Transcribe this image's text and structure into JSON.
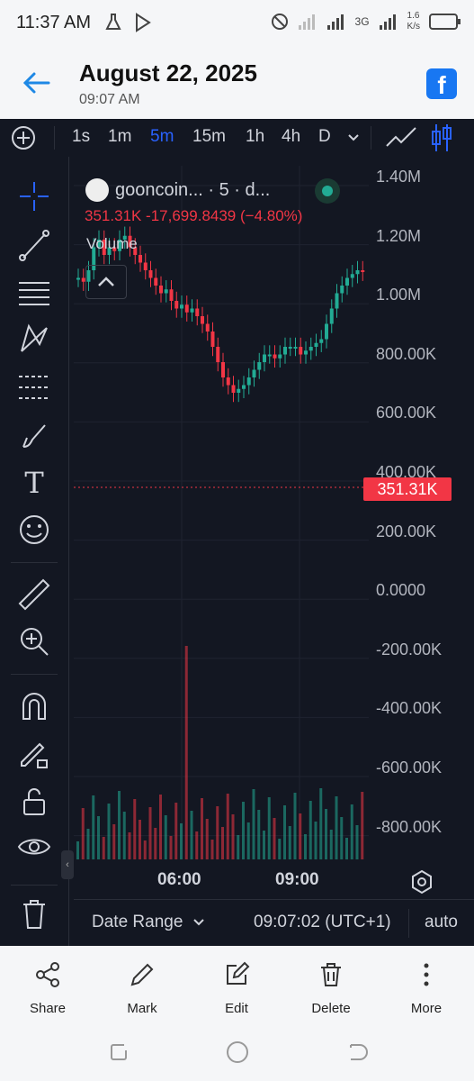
{
  "status_bar": {
    "time": "11:37 AM",
    "net_type": "3G",
    "speed": "1.6",
    "speed_unit": "K/s"
  },
  "header": {
    "date": "August 22, 2025",
    "time": "09:07 AM",
    "facebook_label": "f"
  },
  "toolbar": {
    "timeframes": [
      "1s",
      "1m",
      "5m",
      "15m",
      "1h",
      "4h",
      "D"
    ],
    "active_timeframe": "5m"
  },
  "legend": {
    "title": "gooncoin...  · 5 · d...",
    "values": "351.31K -17,699.8439 (−4.80%)",
    "volume_label": "Volume"
  },
  "price_axis": {
    "labels": [
      "1.40M",
      "1.20M",
      "1.00M",
      "800.00K",
      "600.00K",
      "400.00K",
      "200.00K",
      "0.0000",
      "-200.00K",
      "-400.00K",
      "-600.00K",
      "-800.00K"
    ],
    "current_price": "351.31K"
  },
  "time_axis": {
    "labels": [
      "06:00",
      "09:00"
    ]
  },
  "bottom_bar": {
    "date_range": "Date Range",
    "clock": "09:07:02 (UTC+1)",
    "auto": "auto"
  },
  "actions": [
    {
      "label": "Share",
      "icon": "share-icon"
    },
    {
      "label": "Mark",
      "icon": "pencil-icon"
    },
    {
      "label": "Edit",
      "icon": "edit-icon"
    },
    {
      "label": "Delete",
      "icon": "trash-icon"
    },
    {
      "label": "More",
      "icon": "more-vertical-icon"
    }
  ],
  "colors": {
    "up": "#22ab94",
    "down": "#f23645",
    "accent": "#2962ff",
    "bg": "#131722"
  }
}
